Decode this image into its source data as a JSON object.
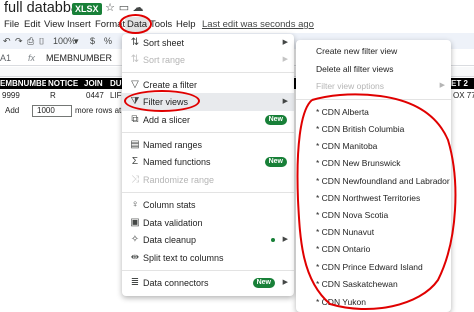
{
  "document": {
    "title": "full databbase",
    "format_badge": "XLSX",
    "last_edit": "Last edit was seconds ago"
  },
  "menu_bar": {
    "items": [
      "File",
      "Edit",
      "View",
      "Insert",
      "Format",
      "Data",
      "Tools",
      "Help"
    ],
    "active": "Data"
  },
  "toolbar": {
    "zoom": "100%",
    "currency": "$",
    "percent": "%"
  },
  "formula_bar": {
    "cell_ref": "A1",
    "value": "MEMBNUMBER"
  },
  "sheet": {
    "headers": [
      "EMBNUMBER",
      "NOTICE",
      "JOIN",
      "DUE",
      "",
      "",
      "",
      "ET 2"
    ],
    "row_values": [
      "9999",
      "R",
      "0447",
      "LIFE",
      "",
      "",
      "",
      "OX 77"
    ],
    "add_rows": {
      "button": "Add",
      "count": "1000",
      "suffix": "more rows at bo"
    }
  },
  "data_menu": {
    "items": [
      {
        "label": "Sort sheet",
        "icon": "sort-icon",
        "submenu": true
      },
      {
        "label": "Sort range",
        "icon": "sort-range-icon",
        "submenu": true,
        "disabled": true
      },
      {
        "label": "Create a filter",
        "icon": "filter-icon"
      },
      {
        "label": "Filter views",
        "icon": "filter-views-icon",
        "submenu": true,
        "highlighted": true
      },
      {
        "label": "Add a slicer",
        "icon": "slicer-icon",
        "badge": "New"
      },
      {
        "label": "Named ranges",
        "icon": "named-ranges-icon"
      },
      {
        "label": "Named functions",
        "icon": "named-functions-icon",
        "badge": "New"
      },
      {
        "label": "Randomize range",
        "icon": "randomize-icon",
        "disabled": true
      },
      {
        "label": "Column stats",
        "icon": "lightbulb-icon"
      },
      {
        "label": "Data validation",
        "icon": "validation-icon"
      },
      {
        "label": "Data cleanup",
        "icon": "cleanup-icon",
        "submenu": true,
        "dot": true
      },
      {
        "label": "Split text to columns",
        "icon": "split-icon"
      },
      {
        "label": "Data connectors",
        "icon": "database-icon",
        "submenu": true,
        "badge": "New"
      }
    ]
  },
  "filter_views_menu": {
    "items": [
      {
        "label": "Create new filter view"
      },
      {
        "label": "Delete all filter views"
      },
      {
        "label": "Filter view options",
        "disabled": true,
        "submenu": true
      }
    ],
    "views": [
      "* CDN Alberta",
      "* CDN British Columbia",
      "* CDN Manitoba",
      "* CDN New Brunswick",
      "* CDN Newfoundland and Labrador",
      "* CDN Northwest Territories",
      "* CDN Nova Scotia",
      "* CDN Nunavut",
      "* CDN Ontario",
      "* CDN Prince Edward Island",
      "* CDN Saskatchewan",
      "* CDN Yukon"
    ]
  },
  "colors": {
    "accent_green": "#188038",
    "annotation_red": "#e00000",
    "toolbar_bg": "#eef2f9"
  }
}
